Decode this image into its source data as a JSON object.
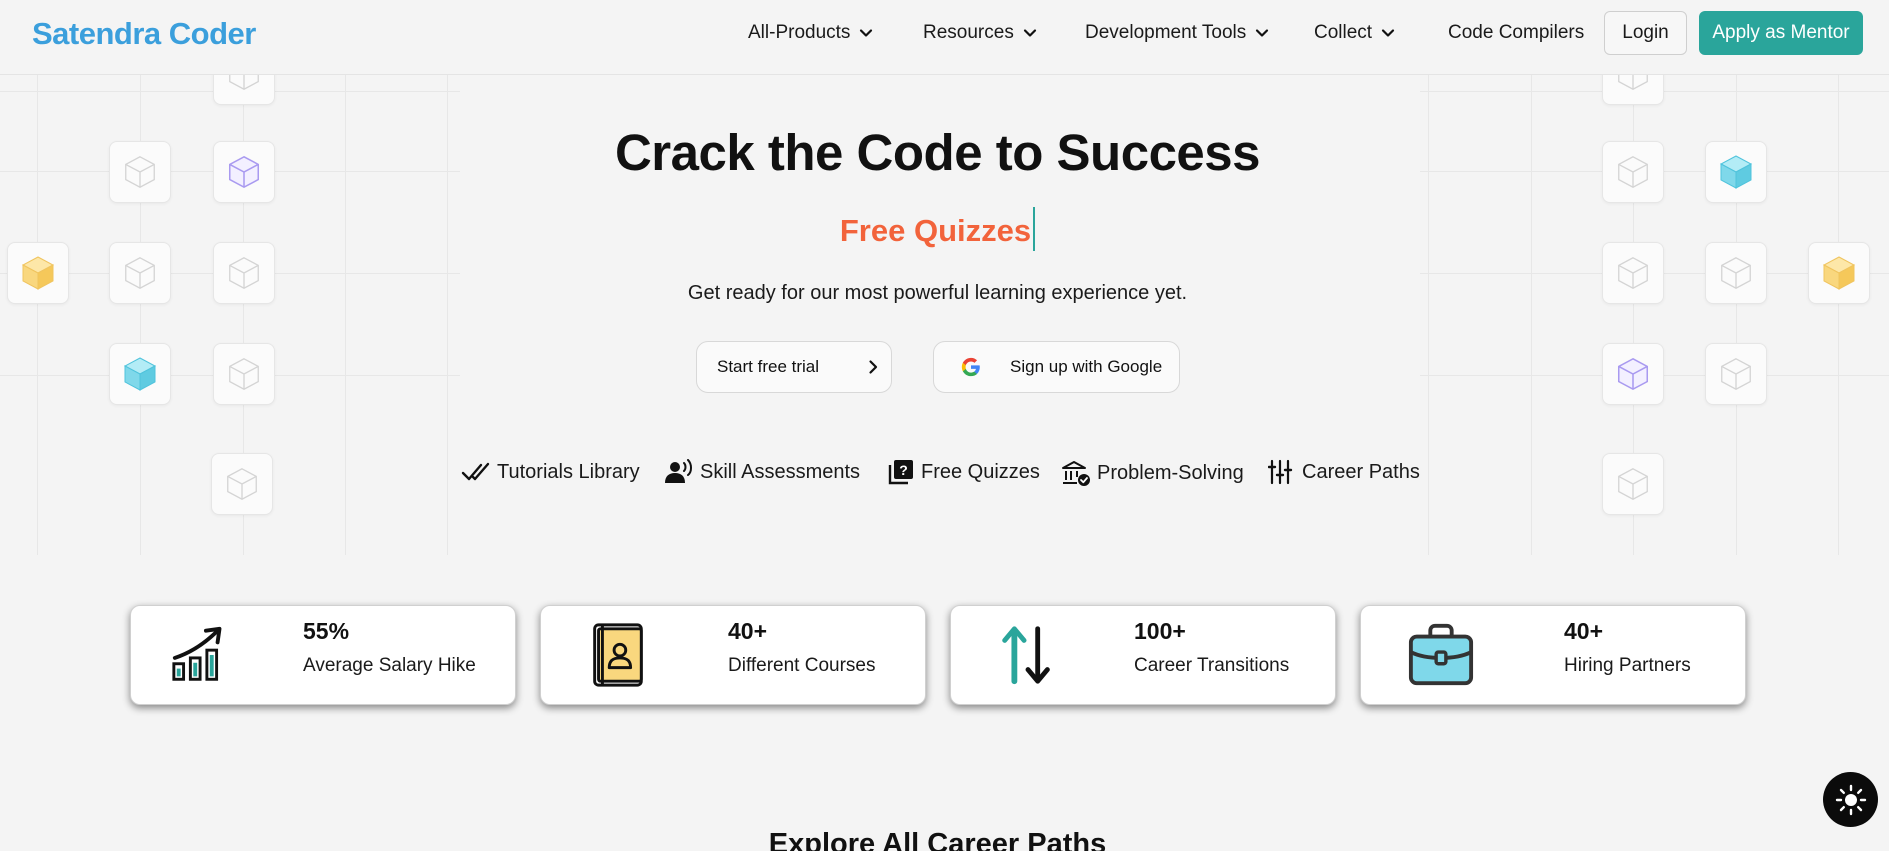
{
  "header": {
    "logo": "Satendra Coder",
    "nav": [
      {
        "label": "All-Products",
        "dropdown": true
      },
      {
        "label": "Resources",
        "dropdown": true
      },
      {
        "label": "Development Tools",
        "dropdown": true
      },
      {
        "label": "Collect",
        "dropdown": true
      },
      {
        "label": "Code Compilers",
        "dropdown": false
      }
    ],
    "login_label": "Login",
    "mentor_label": "Apply as Mentor"
  },
  "hero": {
    "title": "Crack the Code to Success",
    "rotating_text": "Free Quizzes",
    "subtitle": "Get ready for our most powerful learning experience yet.",
    "trial_button": "Start free trial",
    "google_button": "Sign up with Google",
    "features": [
      {
        "icon": "double-check-icon",
        "label": "Tutorials Library"
      },
      {
        "icon": "user-voice-icon",
        "label": "Skill Assessments"
      },
      {
        "icon": "question-book-icon",
        "label": "Free Quizzes"
      },
      {
        "icon": "institution-check-icon",
        "label": "Problem-Solving"
      },
      {
        "icon": "sliders-icon",
        "label": "Career Paths"
      }
    ]
  },
  "stats": [
    {
      "icon": "growth-chart-icon",
      "value": "55%",
      "label": "Average Salary Hike"
    },
    {
      "icon": "contact-book-icon",
      "value": "40+",
      "label": "Different Courses"
    },
    {
      "icon": "up-down-arrows-icon",
      "value": "100+",
      "label": "Career Transitions"
    },
    {
      "icon": "briefcase-icon",
      "value": "40+",
      "label": "Hiring Partners"
    }
  ],
  "section_heading": "Explore All Career Paths",
  "colors": {
    "brand": "#3b9fdc",
    "accent": "#2aa59b",
    "highlight": "#f2633b",
    "cube_yellow": "#f9d77e",
    "cube_cyan": "#7fd8ea",
    "cube_purple": "#a99af0"
  }
}
